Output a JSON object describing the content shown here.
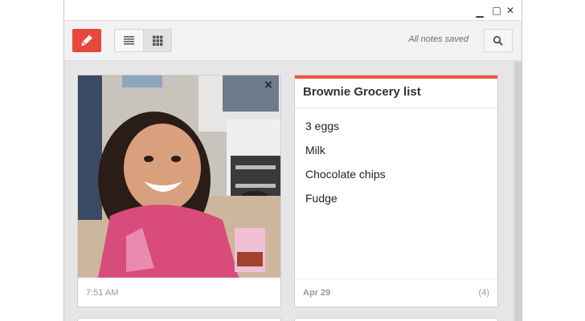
{
  "window": {
    "minimize_glyph": "▁",
    "maximize_glyph": "□",
    "close_glyph": "✕"
  },
  "toolbar": {
    "new_note_icon": "pencil-icon",
    "list_view_icon": "list-view-icon",
    "grid_view_icon": "grid-view-icon",
    "saved_status": "All notes saved",
    "search_icon": "search-icon",
    "accent_color": "#e8473c"
  },
  "notes": [
    {
      "type": "photo",
      "photo_description_icon": "photo-image",
      "remove_glyph": "×",
      "timestamp": "7:51 AM"
    },
    {
      "type": "list",
      "accent_color": "#f0553b",
      "title": "Brownie Grocery list",
      "items": [
        "3 eggs",
        "Milk",
        "Chocolate chips",
        "Fudge"
      ],
      "date": "Apr 29",
      "count": "(4)"
    }
  ]
}
